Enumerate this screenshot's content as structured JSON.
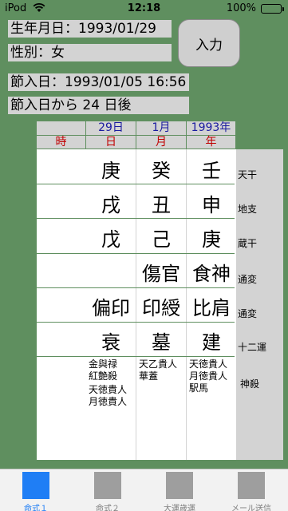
{
  "status": {
    "carrier": "iPod",
    "time": "12:18",
    "battery": "100%"
  },
  "fields": {
    "birth": "生年月日：1993/01/29",
    "gender": "性別：女",
    "setsu": "節入日：1993/01/05 16:56",
    "after": "節入日から 24 日後"
  },
  "input_button": "入力",
  "header": {
    "day_value": "29日",
    "month_value": "1月",
    "year_value": "1993年",
    "hour": "時",
    "day": "日",
    "month": "月",
    "year": "年"
  },
  "rows": [
    {
      "label": "天干",
      "day": "庚",
      "month": "癸",
      "year": "壬"
    },
    {
      "label": "地支",
      "day": "戌",
      "month": "丑",
      "year": "申"
    },
    {
      "label": "蔵干",
      "day": "戊",
      "month": "己",
      "year": "庚"
    },
    {
      "label": "通変",
      "day": "",
      "month": "傷官",
      "year": "食神"
    },
    {
      "label": "通変",
      "day": "偏印",
      "month": "印綬",
      "year": "比肩"
    },
    {
      "label": "十二運",
      "day": "衰",
      "month": "墓",
      "year": "建"
    }
  ],
  "shinsatsu": {
    "label": "神殺",
    "day": [
      "金與禄",
      "紅艶殺",
      "天徳貴人",
      "月徳貴人"
    ],
    "month": [
      "天乙貴人",
      "華蓋"
    ],
    "year": [
      "天徳貴人",
      "月徳貴人",
      "駅馬"
    ]
  },
  "tabs": [
    {
      "label": "命式１",
      "active": true
    },
    {
      "label": "命式２",
      "active": false
    },
    {
      "label": "大運歳運",
      "active": false
    },
    {
      "label": "メール送信",
      "active": false
    }
  ],
  "colors": {
    "background": "#5f8f5f",
    "accent": "#1f7ef5",
    "header_blue": "#1a1aa0",
    "header_red": "#c00000"
  }
}
